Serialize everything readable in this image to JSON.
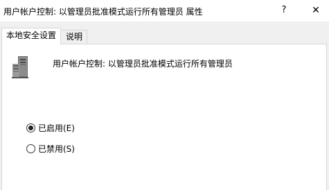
{
  "window": {
    "title": "用户帐户控制: 以管理员批准模式运行所有管理员 属性",
    "help_label": "?",
    "close_label": "✕"
  },
  "tabs": [
    {
      "label": "本地安全设置",
      "active": true
    },
    {
      "label": "说明",
      "active": false
    }
  ],
  "policy": {
    "icon": "server-computer-icon",
    "name": "用户帐户控制: 以管理员批准模式运行所有管理员"
  },
  "options": [
    {
      "label": "已启用(E)",
      "checked": true
    },
    {
      "label": "已禁用(S)",
      "checked": false
    }
  ]
}
